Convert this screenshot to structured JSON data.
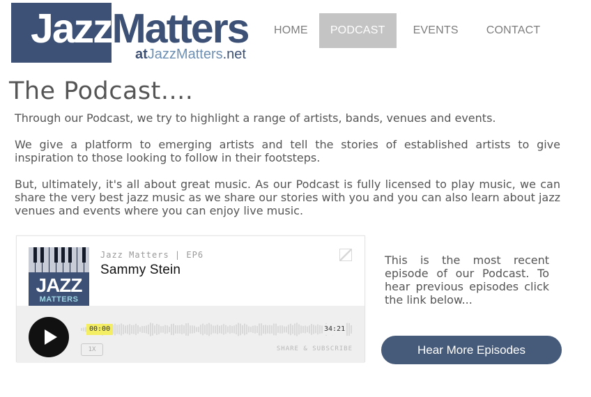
{
  "brand": {
    "logo_word_part1": "Jazz",
    "logo_word_part2": "Matters",
    "logo_sub_at": "at",
    "logo_sub_site": "JazzMatters",
    "logo_sub_tld": ".net",
    "color_primary": "#3d5176",
    "color_accent": "#6d8fb3"
  },
  "nav": {
    "items": [
      {
        "label": "HOME",
        "active": false
      },
      {
        "label": "PODCAST",
        "active": true
      },
      {
        "label": "EVENTS",
        "active": false
      },
      {
        "label": "CONTACT",
        "active": false
      }
    ]
  },
  "page": {
    "title": "The Podcast....",
    "paragraphs": [
      "Through our Podcast, we try to highlight a range of artists, bands, venues and events.",
      "We give a platform to emerging artists and tell the stories of established artists to give inspiration to those looking to follow in their footsteps.",
      "But, ultimately, it's all about great music. As our Podcast is fully licensed to play music, we can share the very best jazz music as we share our stories with you and you can also learn about jazz venues and events where you can enjoy live music."
    ]
  },
  "player": {
    "cover_title": "JAZZ",
    "cover_subtitle": "MATTERS",
    "episode_meta": "Jazz Matters | EP6",
    "episode_title": "Sammy Stein",
    "current_time": "00:00",
    "total_time": "34:21",
    "speed_label": "1X",
    "share_label": "SHARE & SUBSCRIBE",
    "progress": 0.0,
    "icons": {
      "play": "play-icon",
      "corner": "expand-icon"
    }
  },
  "side": {
    "text": "This is the most recent episode of our Podcast. To hear previous episodes click the link below...",
    "button_label": "Hear More Episodes",
    "button_color": "#465a7a"
  }
}
